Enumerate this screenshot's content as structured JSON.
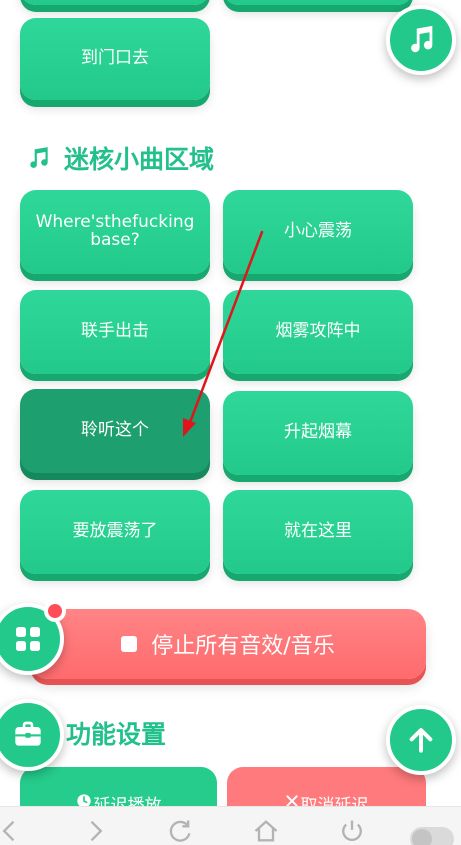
{
  "top_buttons": {
    "partial_left": "",
    "partial_right": "",
    "go_to_door": "到门口去"
  },
  "section_mini_songs": {
    "title": "迷核小曲区域",
    "buttons": [
      {
        "label": "Where'sthefucking base?"
      },
      {
        "label": "小心震荡"
      },
      {
        "label": "联手出击"
      },
      {
        "label": "烟雾攻阵中"
      },
      {
        "label": "聆听这个"
      },
      {
        "label": "升起烟幕"
      },
      {
        "label": "要放震荡了"
      },
      {
        "label": "就在这里"
      }
    ]
  },
  "stop_all": {
    "label": "停止所有音效/音乐"
  },
  "function_settings": {
    "title": "功能设置",
    "delay_label": "延迟播放",
    "cancel_delay_label": "取消延迟"
  },
  "colors": {
    "accent_green": "#22c98a",
    "stop_red": "#ff6b6d",
    "annotation_arrow": "#e0151b"
  },
  "icons": {
    "music_fab": "music-note-icon",
    "grid_fab": "grid-icon",
    "toolbox_fab": "toolbox-icon",
    "scroll_top_fab": "arrow-up-icon"
  }
}
